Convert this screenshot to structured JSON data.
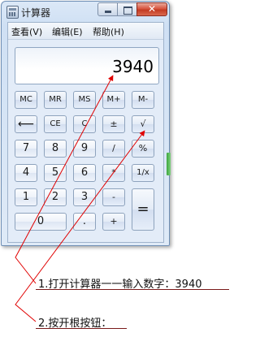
{
  "window": {
    "title": "计算器",
    "minimize_glyph": "",
    "maximize_glyph": "",
    "close_glyph": "✕"
  },
  "menu": {
    "items": [
      {
        "label": "查看(V)"
      },
      {
        "label": "编辑(E)"
      },
      {
        "label": "帮助(H)"
      }
    ]
  },
  "display": {
    "value": "3940"
  },
  "keys": {
    "mc": "MC",
    "mr": "MR",
    "ms": "MS",
    "mplus": "M+",
    "mminus": "M-",
    "backspace": "⟵",
    "ce": "CE",
    "c": "C",
    "plusminus": "±",
    "sqrt": "√",
    "k7": "7",
    "k8": "8",
    "k9": "9",
    "div": "/",
    "percent": "%",
    "k4": "4",
    "k5": "5",
    "k6": "6",
    "mul": "*",
    "recip": "1/x",
    "k1": "1",
    "k2": "2",
    "k3": "3",
    "sub": "-",
    "eq": "=",
    "k0": "0",
    "dot": ".",
    "add": "+"
  },
  "annotations": {
    "step1": "1.打开计算器一一输入数字：3940",
    "step2": "2.按开根按钮："
  },
  "colors": {
    "annotation_line": "#7a1a1a",
    "arrow": "#e00000",
    "gripper": "#3da53d"
  }
}
